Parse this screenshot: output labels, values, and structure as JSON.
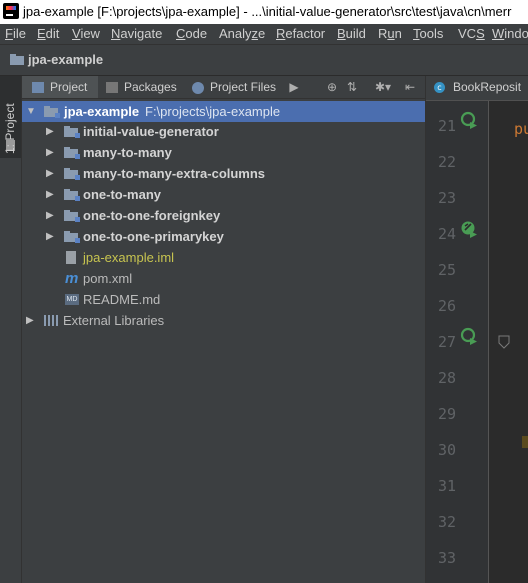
{
  "window": {
    "title": "jpa-example [F:\\projects\\jpa-example] - ...\\initial-value-generator\\src\\test\\java\\cn\\merr"
  },
  "menu": [
    {
      "label": "File",
      "mn": "F"
    },
    {
      "label": "Edit",
      "mn": "E"
    },
    {
      "label": "View",
      "mn": "V"
    },
    {
      "label": "Navigate",
      "mn": "N"
    },
    {
      "label": "Code",
      "mn": "C"
    },
    {
      "label": "Analyze",
      "mn": "z"
    },
    {
      "label": "Refactor",
      "mn": "R"
    },
    {
      "label": "Build",
      "mn": "B"
    },
    {
      "label": "Run",
      "mn": "u"
    },
    {
      "label": "Tools",
      "mn": "T"
    },
    {
      "label": "VCS",
      "mn": "S"
    },
    {
      "label": "Windo",
      "mn": "W"
    }
  ],
  "breadcrumb": {
    "label": "jpa-example"
  },
  "side_strip": {
    "tab_label": "1: Project"
  },
  "panel": {
    "tabs": [
      {
        "label": "Project",
        "active": true,
        "icon": "project-icon"
      },
      {
        "label": "Packages",
        "active": false,
        "icon": "packages-icon"
      },
      {
        "label": "Project Files",
        "active": false,
        "icon": "project-files-icon"
      }
    ],
    "more_glyph": "▶",
    "buttons": [
      {
        "name": "locate-icon",
        "glyph": "⊕"
      },
      {
        "name": "collapse-all-icon",
        "glyph": "⇅"
      },
      {
        "name": "settings-icon",
        "glyph": "✱▾"
      },
      {
        "name": "hide-icon",
        "glyph": "⇤"
      }
    ]
  },
  "tree": {
    "root": {
      "name": "jpa-example",
      "path": "F:\\projects\\jpa-example"
    },
    "modules": [
      {
        "name": "initial-value-generator"
      },
      {
        "name": "many-to-many"
      },
      {
        "name": "many-to-many-extra-columns"
      },
      {
        "name": "one-to-many"
      },
      {
        "name": "one-to-one-foreignkey"
      },
      {
        "name": "one-to-one-primarykey"
      }
    ],
    "files": [
      {
        "name": "jpa-example.iml",
        "color": "#c7c450",
        "icon": "iml-file-icon"
      },
      {
        "name": "pom.xml",
        "color": "#bbbbbb",
        "icon": "maven-file-icon",
        "glyph": "m"
      },
      {
        "name": "README.md",
        "color": "#bbbbbb",
        "icon": "markdown-file-icon",
        "glyph": "MD"
      }
    ],
    "external": {
      "name": "External Libraries"
    }
  },
  "editor": {
    "tab_label": "BookReposit",
    "line_numbers": [
      "21",
      "22",
      "23",
      "24",
      "25",
      "26",
      "27",
      "28",
      "29",
      "30",
      "31",
      "32",
      "33"
    ],
    "code_fragment": "pu"
  },
  "colors": {
    "selection": "#4b6eaf",
    "panel_bg": "#3c3f41",
    "editor_bg": "#2b2b2b",
    "run_green": "#499c54",
    "keyword": "#cc7832"
  }
}
